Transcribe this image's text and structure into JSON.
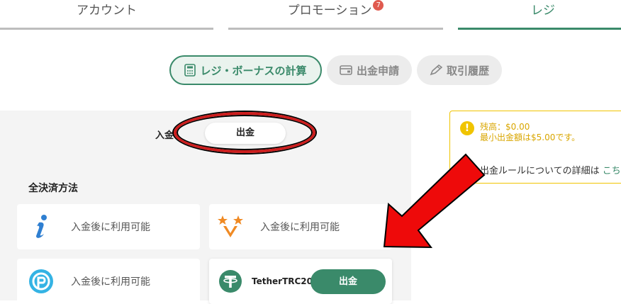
{
  "tabs": [
    {
      "label": "アカウント"
    },
    {
      "label": "プロモーション",
      "badge": "7"
    },
    {
      "label": "レジ"
    }
  ],
  "subnav": {
    "calc": "レジ・ボーナスの計算",
    "withdraw_request": "出金申請",
    "history": "取引履歴"
  },
  "toggle": {
    "deposit": "入金",
    "withdraw": "出金"
  },
  "section_title": "全決済方法",
  "methods": [
    {
      "label": "入金後に利用可能",
      "icon": "i-icon"
    },
    {
      "label": "入金後に利用可能",
      "icon": "star-v-icon"
    },
    {
      "label": "入金後に利用可能",
      "icon": "p-circle-icon"
    },
    {
      "label": "TetherTRC20",
      "icon": "tether-icon",
      "button": "出金"
    }
  ],
  "info": {
    "balance": "残高：$0.00",
    "min_withdraw": "最小出金額は$5.00です。",
    "rules_text": "出金ルールについての詳細は",
    "rules_link": "こちら"
  },
  "colors": {
    "accent": "#3a8a6a",
    "warning": "#f0c400",
    "annotation": "#cc1d1d"
  }
}
